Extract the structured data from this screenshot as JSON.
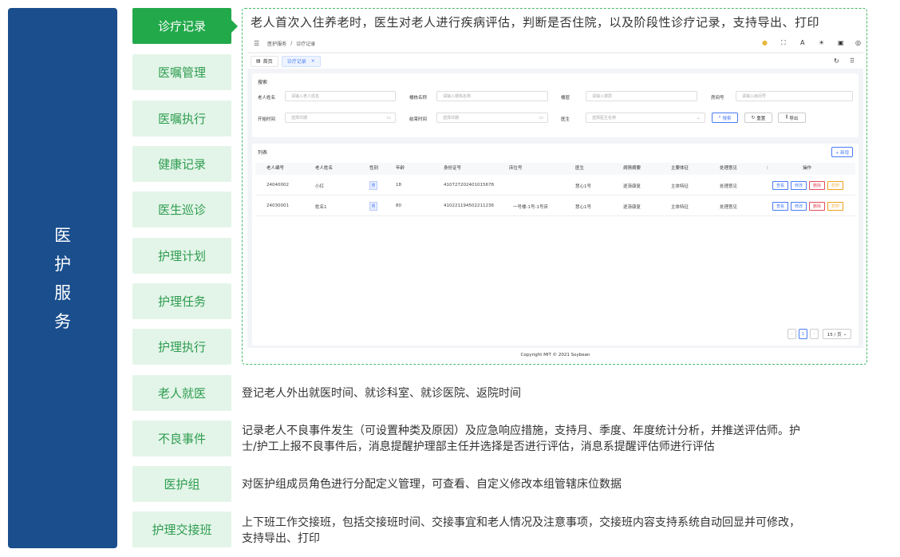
{
  "sidebar": {
    "title": "医护服务"
  },
  "menu": [
    {
      "label": "诊疗记录",
      "active": true
    },
    {
      "label": "医嘱管理"
    },
    {
      "label": "医嘱执行"
    },
    {
      "label": "健康记录"
    },
    {
      "label": "医生巡诊"
    },
    {
      "label": "护理计划"
    },
    {
      "label": "护理任务"
    },
    {
      "label": "护理执行"
    },
    {
      "label": "老人就医"
    },
    {
      "label": "不良事件"
    },
    {
      "label": "医护组"
    },
    {
      "label": "护理交接班"
    }
  ],
  "frame": {
    "title": "老人首次入住养老时，医生对老人进行疾病评估，判断是否住院，以及阶段性诊疗记录，支持导出、打印"
  },
  "descriptions": {
    "jiuyi": "登记老人外出就医时间、就诊科室、就诊医院、返院时间",
    "buliang_1": "记录老人不良事件发生（可设置种类及原因）及应急响应措施，支持月、季度、年度统计分析，并推送评估师。护",
    "buliang_2": "士/护工上报不良事件后，消息提醒护理部主任并选择是否进行评估，消息系提醒评估师进行评估",
    "yihuzu": "对医护组成员角色进行分配定义管理，可查看、自定义修改本组管辖床位数据",
    "jiaojie_1": "上下班工作交接班，包括交接班时间、交接事宜和老人情况及注意事项，交接班内容支持系统自动回显并可修改，",
    "jiaojie_2": "支持导出、打印"
  },
  "app": {
    "breadcrumb": {
      "root": "医护服务",
      "sep": "/",
      "current": "诊疗记录"
    },
    "tabs": {
      "home": "首页",
      "current": "诊疗记录",
      "close": "×"
    },
    "search": {
      "title": "搜索",
      "name_label": "老人姓名",
      "name_ph": "请输入老人姓名",
      "building_label": "楼栋名称",
      "building_ph": "请输入楼栋名称",
      "floor_label": "楼层",
      "floor_ph": "请输入楼层",
      "room_label": "房间号",
      "room_ph": "请输入房间号",
      "start_label": "开始时间",
      "start_ph": "选择日期",
      "end_label": "结束时间",
      "end_ph": "选择日期",
      "doctor_label": "医生",
      "doctor_ph": "选择医生名称",
      "search_btn": "搜索",
      "reset_btn": "重置",
      "export_btn": "导出"
    },
    "list": {
      "title": "列表",
      "add_btn": "+ 新增",
      "columns": [
        "老人编号",
        "老人姓名",
        "性别",
        "年龄",
        "身份证号",
        "床位号",
        "医生",
        "病情摘要",
        "主要体征",
        "处理意见",
        "操作"
      ],
      "rows": [
        {
          "id": "24040002",
          "name": "小红",
          "sex": "男",
          "age": "18",
          "idcard": "410727202401015678",
          "bed": "",
          "doctor": "慧心1号",
          "summary": "逐渐康复",
          "sign": "主体特征",
          "opinion": "处理意见"
        },
        {
          "id": "24030001",
          "name": "姓名1",
          "sex": "男",
          "age": "80",
          "idcard": "410221194502211236",
          "bed": "一号楼-1号-1号床",
          "doctor": "慧心1号",
          "summary": "逐渐康复",
          "sign": "主体特征",
          "opinion": "处理意见"
        }
      ],
      "actions": {
        "view": "查看",
        "edit": "修改",
        "del": "删除",
        "print": "打印"
      },
      "pagination": {
        "page": "1",
        "size": "15 / 页"
      }
    },
    "footer": "Copyright MIT © 2021 Soybean"
  },
  "colors": {
    "navy": "#1a4e8d",
    "green": "#22a94a",
    "light_green": "#e3f5e8",
    "blue": "#4a7bf7"
  }
}
